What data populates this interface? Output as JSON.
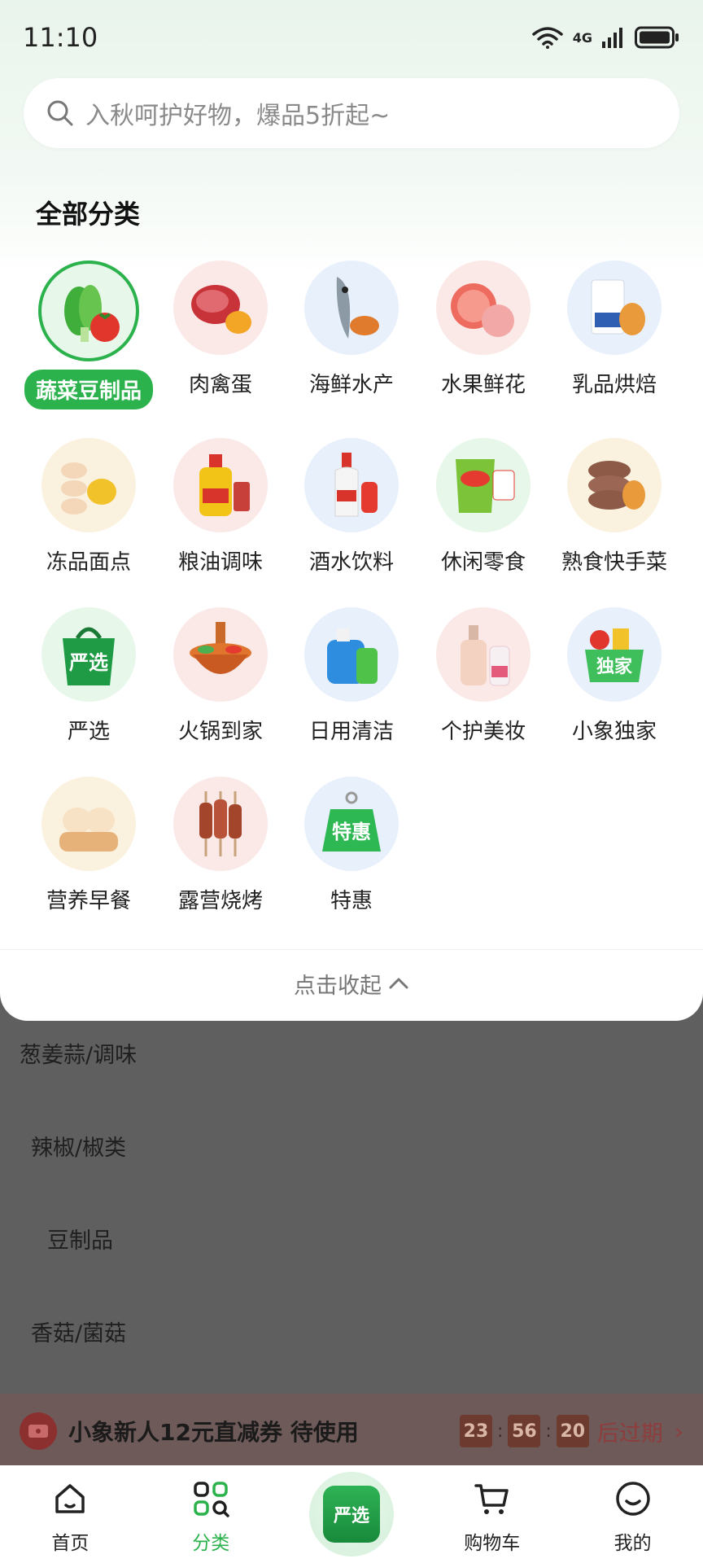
{
  "status_bar": {
    "time": "11:10",
    "network": "4G"
  },
  "search": {
    "placeholder": "入秋呵护好物，爆品5折起~"
  },
  "section_title": "全部分类",
  "categories": [
    {
      "label": "蔬菜豆制品",
      "icon": "vegetables-icon",
      "selected": true,
      "color": "#e7f7ea"
    },
    {
      "label": "肉禽蛋",
      "icon": "meat-egg-icon",
      "color": "#fbe9e8"
    },
    {
      "label": "海鲜水产",
      "icon": "seafood-icon",
      "color": "#e8f0fb"
    },
    {
      "label": "水果鲜花",
      "icon": "fruit-icon",
      "color": "#fbe9e8"
    },
    {
      "label": "乳品烘焙",
      "icon": "dairy-bakery-icon",
      "color": "#e8f0fb"
    },
    {
      "label": "冻品面点",
      "icon": "frozen-dumpling-icon",
      "color": "#fbf1df"
    },
    {
      "label": "粮油调味",
      "icon": "oil-seasoning-icon",
      "color": "#fbe9e8"
    },
    {
      "label": "酒水饮料",
      "icon": "drinks-icon",
      "color": "#e8f0fb"
    },
    {
      "label": "休闲零食",
      "icon": "snacks-icon",
      "color": "#e7f7ea"
    },
    {
      "label": "熟食快手菜",
      "icon": "deli-icon",
      "color": "#fbf1df"
    },
    {
      "label": "严选",
      "icon": "yanxuan-bag-icon",
      "color": "#e7f7ea"
    },
    {
      "label": "火锅到家",
      "icon": "hotpot-icon",
      "color": "#fbe9e8"
    },
    {
      "label": "日用清洁",
      "icon": "cleaning-icon",
      "color": "#e8f0fb"
    },
    {
      "label": "个护美妆",
      "icon": "beauty-icon",
      "color": "#fbe9e8"
    },
    {
      "label": "小象独家",
      "icon": "exclusive-basket-icon",
      "color": "#e8f0fb"
    },
    {
      "label": "营养早餐",
      "icon": "breakfast-icon",
      "color": "#fbf1df"
    },
    {
      "label": "露营烧烤",
      "icon": "bbq-icon",
      "color": "#fbe9e8"
    },
    {
      "label": "特惠",
      "icon": "special-offer-icon",
      "color": "#e8f0fb"
    }
  ],
  "collapse_label": "点击收起",
  "background_list": [
    "葱姜蒜/调味",
    "辣椒/椒类",
    "豆制品",
    "香菇/菌菇"
  ],
  "coupon": {
    "text": "小象新人12元直减券 待使用",
    "h": "23",
    "m": "56",
    "s": "20",
    "expire": "后过期"
  },
  "tabbar": {
    "home": "首页",
    "category": "分类",
    "center": "严选",
    "cart": "购物车",
    "mine": "我的"
  },
  "colors": {
    "accent": "#2bb24c",
    "coupon_red": "#e03a3a"
  }
}
